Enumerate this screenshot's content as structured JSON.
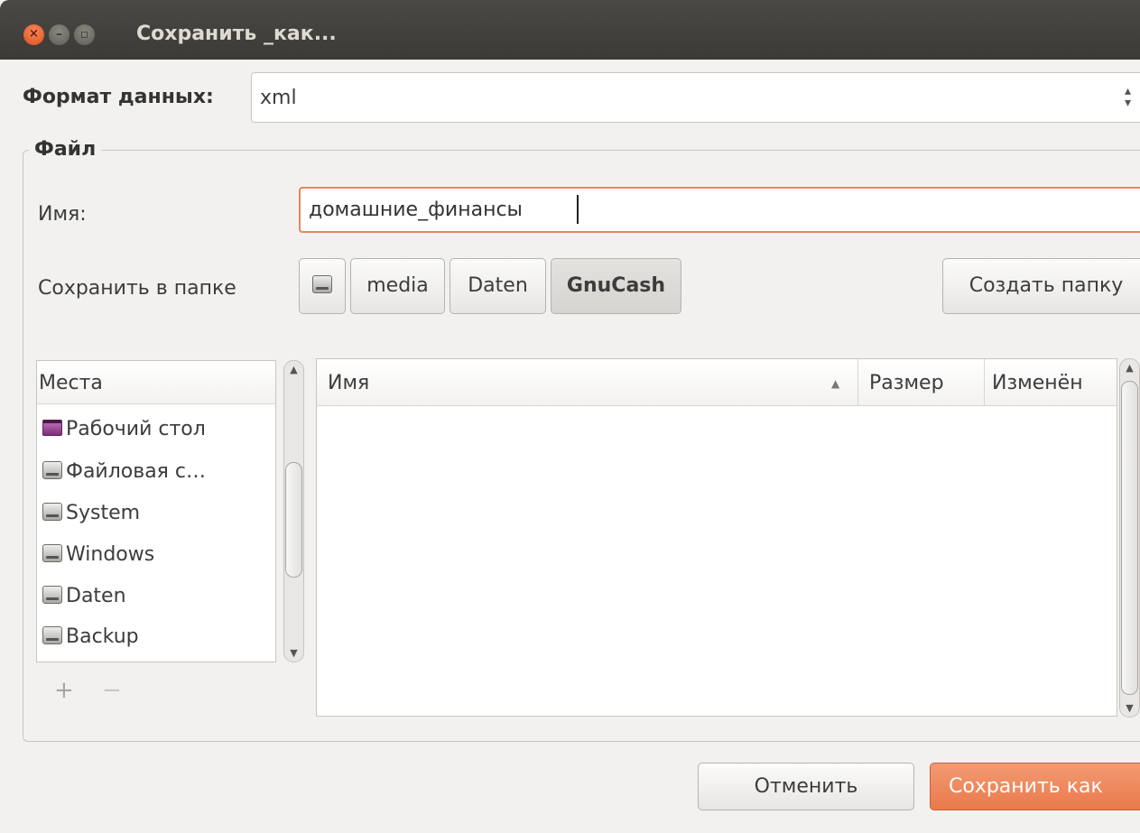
{
  "window": {
    "title": "Сохранить _как..."
  },
  "format": {
    "label": "Формат данных:",
    "value": "xml"
  },
  "file_section": {
    "title": "Файл",
    "name_label": "Имя:",
    "name_value": "домашние_финансы",
    "folder_label": "Сохранить в папке",
    "path": [
      "media",
      "Daten",
      "GnuCash"
    ],
    "create_folder": "Создать папку"
  },
  "places": {
    "header": "Места",
    "items": [
      {
        "label": "Рабочий стол",
        "icon": "desktop-icon"
      },
      {
        "label": "Файловая с…",
        "icon": "drive-icon"
      },
      {
        "label": "System",
        "icon": "drive-icon"
      },
      {
        "label": "Windows",
        "icon": "drive-icon"
      },
      {
        "label": "Daten",
        "icon": "drive-icon"
      },
      {
        "label": "Backup",
        "icon": "drive-icon"
      }
    ],
    "add": "+",
    "remove": "−"
  },
  "files": {
    "columns": [
      "Имя",
      "Размер",
      "Изменён"
    ],
    "rows": []
  },
  "buttons": {
    "cancel": "Отменить",
    "save": "Сохранить как"
  },
  "colors": {
    "accent": "#e97a4c",
    "titlebar": "#3b3a36",
    "background": "#f2f1f0"
  }
}
